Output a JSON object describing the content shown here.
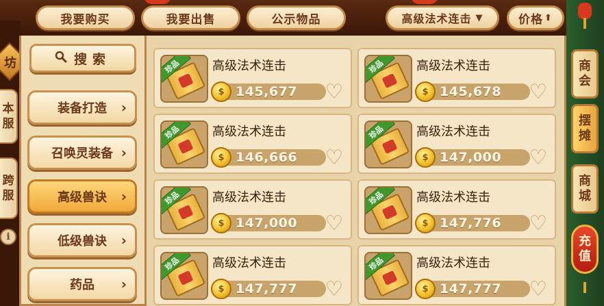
{
  "top_tabs": {
    "buy": "我要购买",
    "sell": "我要出售",
    "public": "公示物品",
    "filter": "高级法术连击",
    "filter_arrow": "▼",
    "sort": "价格",
    "sort_arrow": "⬆"
  },
  "left_ribbon": {
    "badge": "坊",
    "this_server": [
      "本",
      "服"
    ],
    "cross_server": [
      "跨",
      "服"
    ],
    "info": "i"
  },
  "search": {
    "icon": "search-icon",
    "label": "搜索"
  },
  "categories": [
    {
      "label": "装备打造",
      "active": false
    },
    {
      "label": "召唤灵装备",
      "active": false
    },
    {
      "label": "高级兽诀",
      "active": true
    },
    {
      "label": "低级兽诀",
      "active": false
    },
    {
      "label": "药品",
      "active": false
    }
  ],
  "chevron": "›",
  "listings": [
    {
      "name": "高级法术连击",
      "price": "145,677",
      "badge": "珍品"
    },
    {
      "name": "高级法术连击",
      "price": "145,678",
      "badge": "珍品"
    },
    {
      "name": "高级法术连击",
      "price": "146,666",
      "badge": "珍品"
    },
    {
      "name": "高级法术连击",
      "price": "147,000",
      "badge": "珍品"
    },
    {
      "name": "高级法术连击",
      "price": "147,000",
      "badge": "珍品"
    },
    {
      "name": "高级法术连击",
      "price": "147,776",
      "badge": "珍品"
    },
    {
      "name": "高级法术连击",
      "price": "147,777",
      "badge": "珍品"
    },
    {
      "name": "高级法术连击",
      "price": "147,777",
      "badge": "珍品"
    }
  ],
  "coin_symbol": "$",
  "fav_icon": "♡",
  "side_menu": [
    {
      "chars": [
        "商",
        "会"
      ],
      "active": false
    },
    {
      "chars": [
        "摆",
        "摊"
      ],
      "active": true
    },
    {
      "chars": [
        "商",
        "城"
      ],
      "active": false
    },
    {
      "chars": [
        "充",
        "值"
      ],
      "active": false
    }
  ],
  "colors": {
    "accent": "#f0a83a",
    "panel": "#efdcb3",
    "gem_badge": "#3e9a2c",
    "charge": "#d8361d"
  }
}
